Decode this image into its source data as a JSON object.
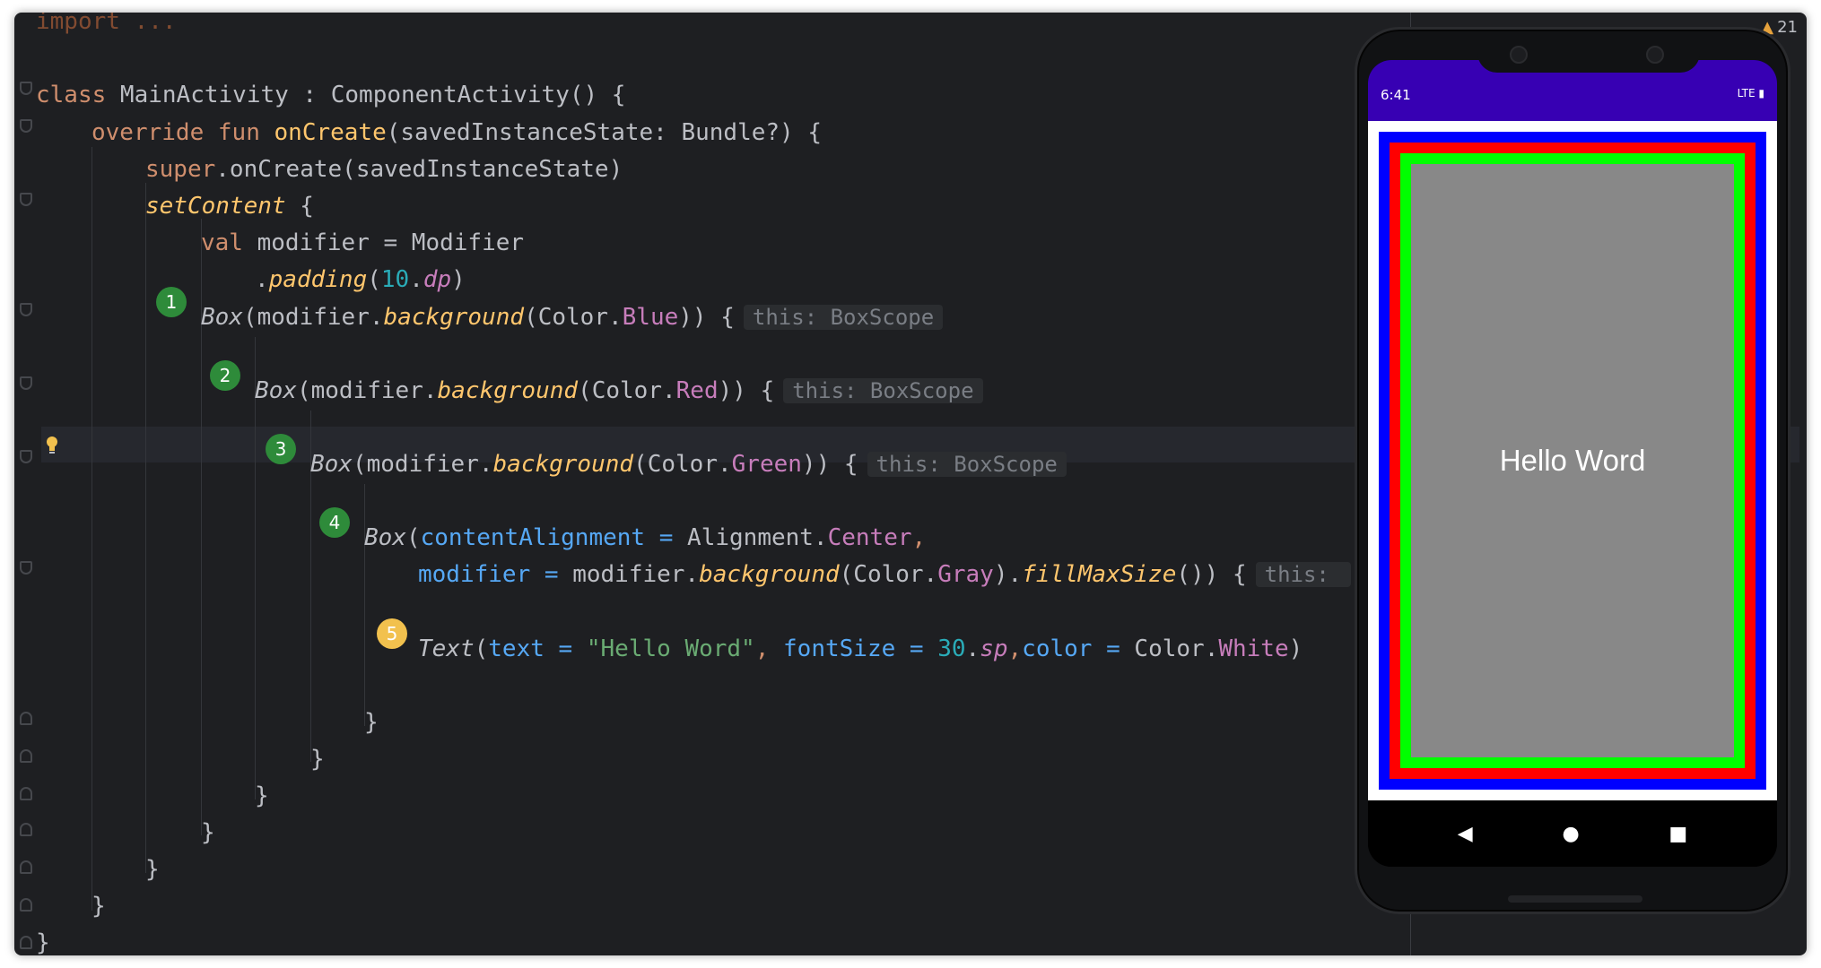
{
  "editor": {
    "lines": [
      {
        "id": "import",
        "text": "import ..."
      },
      {
        "id": "class",
        "kw": "class",
        "rest": " MainActivity : ComponentActivity() {"
      },
      {
        "id": "override",
        "kw1": "override",
        "kw2": " fun ",
        "fn": "onCreate",
        "rest": "(savedInstanceState: Bundle?) {"
      },
      {
        "id": "super",
        "kw": "super",
        "rest": ".onCreate(savedInstanceState)"
      },
      {
        "id": "setContent",
        "call": "setContent",
        "rest": " {"
      },
      {
        "id": "val",
        "kw": "val",
        "rest": " modifier = Modifier"
      },
      {
        "id": "padding",
        "pre": ".",
        "call": "padding",
        "p1": "(",
        "num": "10",
        "dot": ".",
        "prop": "dp",
        "p2": ")"
      },
      {
        "id": "box1",
        "name": "Box",
        "a": "(modifier.",
        "call": "background",
        "b": "(Color.",
        "prop": "Blue",
        "c": ")) {",
        "hint": "this: BoxScope"
      },
      {
        "id": "box2",
        "name": "Box",
        "a": "(modifier.",
        "call": "background",
        "b": "(Color.",
        "prop": "Red",
        "c": ")) {",
        "hint": "this: BoxScope"
      },
      {
        "id": "box3",
        "name": "Box",
        "a": "(modifier.",
        "call": "background",
        "b": "(Color.",
        "prop": "Green",
        "c": ")) {",
        "hint": "this: BoxScope"
      },
      {
        "id": "box4",
        "name": "Box",
        "a": "(",
        "param": "contentAlignment",
        "eq": " = ",
        "b": "Alignment.",
        "prop": "Center",
        "c": ","
      },
      {
        "id": "box4b",
        "param": "modifier",
        "eq": " = ",
        "a": "modifier.",
        "call": "background",
        "b": "(Color.",
        "prop": "Gray",
        "c": ").",
        "call2": "fillMaxSize",
        "d": "()) {",
        "hint": "this: "
      },
      {
        "id": "text",
        "name": "Text",
        "a": "(",
        "param1": "text",
        "eq1": " = ",
        "str": "\"Hello Word\"",
        "comma1": ", ",
        "param2": "fontSize",
        "eq2": " = ",
        "num": "30",
        "dot": ".",
        "prop1": "sp",
        "comma2": ",",
        "param3": "color",
        "eq3": " = ",
        "b": "Color.",
        "prop2": "White",
        "c": ")"
      },
      {
        "id": "close5",
        "text": "}"
      },
      {
        "id": "close4",
        "text": "}"
      },
      {
        "id": "close3",
        "text": "}"
      },
      {
        "id": "close2",
        "text": "}"
      },
      {
        "id": "close1",
        "text": "}"
      },
      {
        "id": "close0",
        "text": "}"
      },
      {
        "id": "closeClass",
        "text": "}"
      }
    ],
    "badges": [
      "1",
      "2",
      "3",
      "4",
      "5"
    ]
  },
  "inspection": {
    "warning_count": "21"
  },
  "phone": {
    "status_time": "6:41",
    "status_right": "LTE",
    "hello_text": "Hello Word",
    "colors": {
      "statusbar": "#3700b3",
      "blue": "#0000ff",
      "red": "#ff0000",
      "green": "#00ff00",
      "gray": "#888888"
    }
  }
}
